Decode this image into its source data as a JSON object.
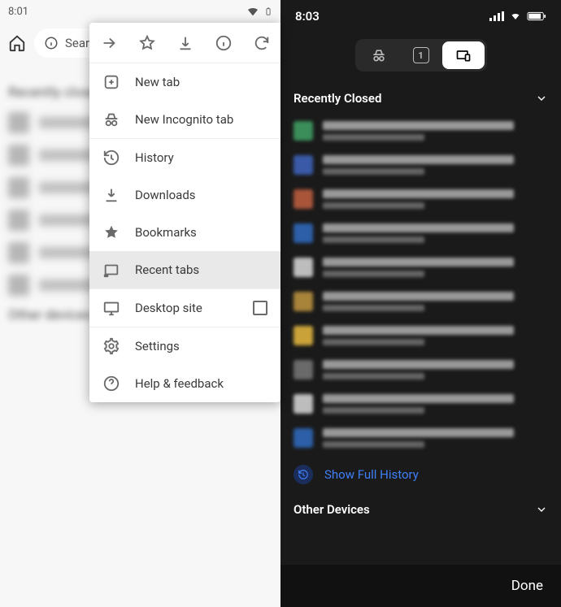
{
  "android": {
    "status": {
      "time": "8:01"
    },
    "search_placeholder": "Search",
    "sections": {
      "recently_closed": "Recently closed",
      "other_devices": "Other devices"
    },
    "menu": {
      "new_tab": "New tab",
      "incognito": "New Incognito tab",
      "history": "History",
      "downloads": "Downloads",
      "bookmarks": "Bookmarks",
      "recent_tabs": "Recent tabs",
      "desktop": "Desktop site",
      "settings": "Settings",
      "help": "Help & feedback"
    }
  },
  "ios": {
    "status": {
      "time": "8:03"
    },
    "tab_count": "1",
    "recently_closed": "Recently Closed",
    "show_full_history": "Show Full History",
    "other_devices": "Other Devices",
    "done": "Done"
  },
  "thumb_colors": [
    "#3b8e5a",
    "#3a5aa8",
    "#a8553a",
    "#2d5fa8",
    "#bdbdbd",
    "#a8843a",
    "#c9a23a",
    "#6a6a6a",
    "#bdbdbd",
    "#2d5fa8"
  ]
}
